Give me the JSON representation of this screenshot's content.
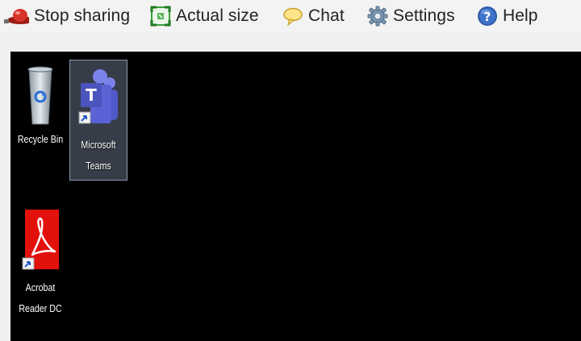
{
  "toolbar": {
    "items": [
      {
        "label": "Stop sharing",
        "icon": "stop-sharing-icon"
      },
      {
        "label": "Actual size",
        "icon": "actual-size-icon"
      },
      {
        "label": "Chat",
        "icon": "chat-bubble-icon"
      },
      {
        "label": "Settings",
        "icon": "gear-icon"
      },
      {
        "label": "Help",
        "icon": "help-icon"
      }
    ]
  },
  "desktop": {
    "background": "#000000",
    "icons": [
      {
        "label": "Recycle Bin",
        "icon": "recycle-bin-icon",
        "selected": false
      },
      {
        "label": "Microsoft\nTeams",
        "icon": "microsoft-teams-icon",
        "selected": true
      },
      {
        "label": "Acrobat\nReader DC",
        "icon": "acrobat-reader-icon",
        "selected": false
      }
    ]
  },
  "colors": {
    "toolbar_bg": "#f3f3f3",
    "teams_purple": "#5059c9",
    "acrobat_red": "#e3110b",
    "help_blue": "#2f5aa8"
  }
}
